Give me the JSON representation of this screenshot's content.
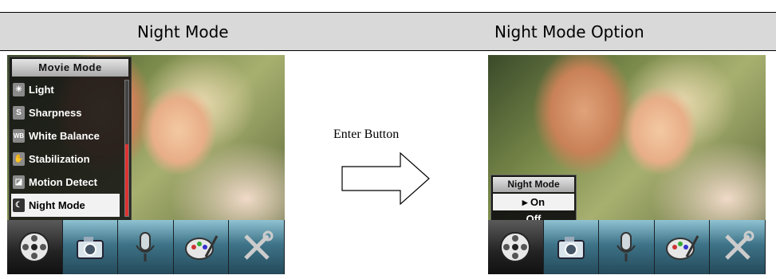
{
  "header": {
    "left_title": "Night Mode",
    "right_title": "Night Mode Option"
  },
  "left_screen": {
    "menu": {
      "title": "Movie Mode",
      "items": [
        {
          "label": "Light",
          "icon": "light-icon",
          "glyph": "☀"
        },
        {
          "label": "Sharpness",
          "icon": "sharpness-icon",
          "glyph": "S"
        },
        {
          "label": "White Balance",
          "icon": "white-balance-icon",
          "glyph": "WB"
        },
        {
          "label": "Stabilization",
          "icon": "stabilization-icon",
          "glyph": "✋"
        },
        {
          "label": "Motion Detect",
          "icon": "motion-detect-icon",
          "glyph": "◪"
        },
        {
          "label": "Night Mode",
          "icon": "night-mode-icon",
          "glyph": "☾"
        }
      ],
      "selected": "Night Mode"
    }
  },
  "arrow": {
    "label": "Enter Button"
  },
  "right_screen": {
    "popup": {
      "title": "Night Mode",
      "options": [
        "▸ On",
        "Off"
      ],
      "selected": "▸ On"
    }
  },
  "toolbar": {
    "tools": [
      "movie-mode-icon",
      "camera-mode-icon",
      "voice-record-icon",
      "effect-icon",
      "setup-icon"
    ],
    "active": "movie-mode-icon"
  },
  "colors": {
    "header_bg": "#d9d9d9",
    "menu_bg": "#141414",
    "selection_bg": "#f2f2f2",
    "toolbar_teal": "#3e7388",
    "scroll_thumb": "#dd3333"
  }
}
